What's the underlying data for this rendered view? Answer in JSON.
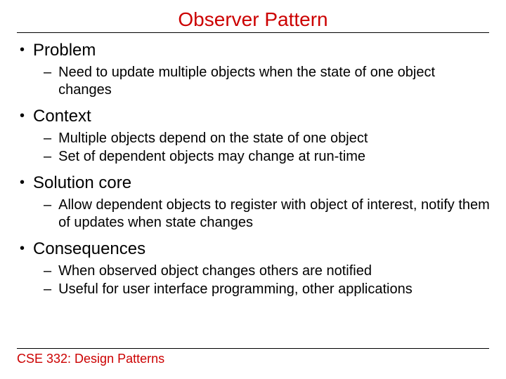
{
  "title": "Observer Pattern",
  "sections": [
    {
      "heading": "Problem",
      "items": [
        "Need to update multiple objects when the state of one object changes"
      ]
    },
    {
      "heading": "Context",
      "items": [
        "Multiple objects depend on the state of one object",
        "Set of dependent objects may change at run-time"
      ]
    },
    {
      "heading": "Solution core",
      "items": [
        "Allow dependent objects to register with object of interest, notify them of updates when state changes"
      ]
    },
    {
      "heading": "Consequences",
      "items": [
        "When observed object changes others are notified",
        "Useful for user interface programming, other applications"
      ]
    }
  ],
  "footer": "CSE 332: Design Patterns"
}
